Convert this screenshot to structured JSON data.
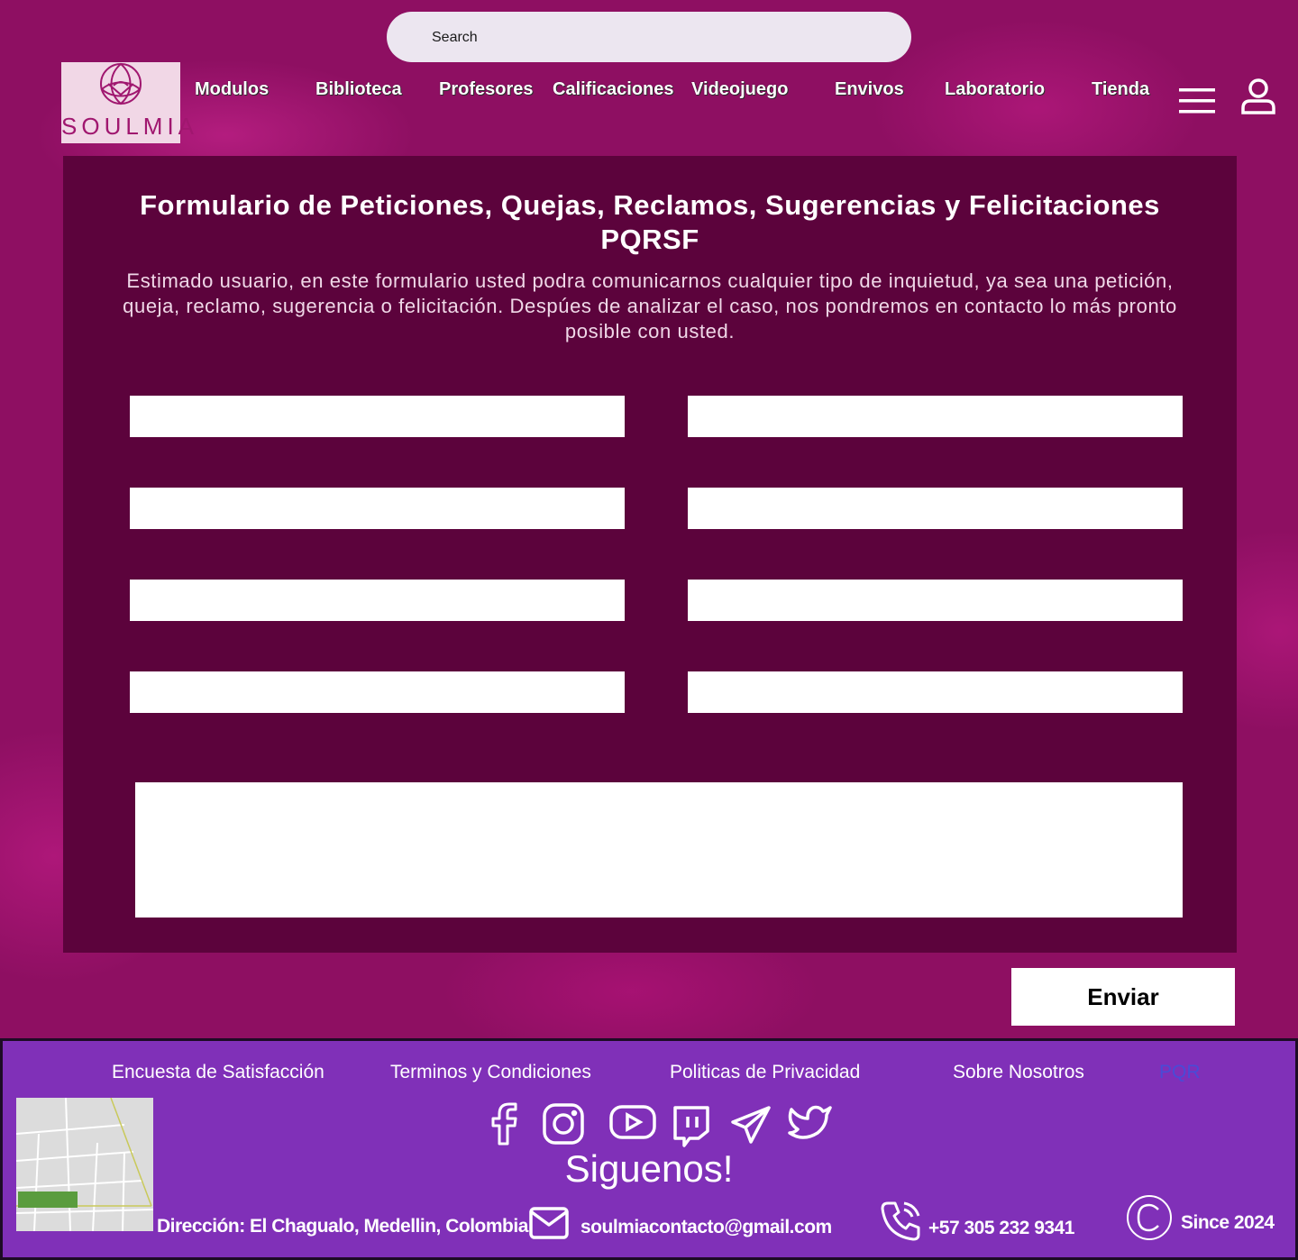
{
  "search": {
    "placeholder": "Search"
  },
  "brand": {
    "name": "SOULMIA"
  },
  "nav": {
    "items": [
      {
        "label": "Modulos"
      },
      {
        "label": "Biblioteca"
      },
      {
        "label": "Profesores"
      },
      {
        "label": "Calificaciones"
      },
      {
        "label": "Videojuego"
      },
      {
        "label": "Envivos"
      },
      {
        "label": "Laboratorio"
      },
      {
        "label": "Tienda"
      }
    ],
    "menu_icon": "hamburger-menu-icon",
    "user_icon": "user-icon"
  },
  "form": {
    "title_line1": "Formulario de Peticiones, Quejas, Reclamos, Sugerencias y Felicitaciones",
    "title_line2": "PQRSF",
    "description": "Estimado usuario, en este formulario usted podra comunicarnos cualquier tipo de inquietud, ya sea una petición, queja, reclamo, sugerencia o felicitación. Despúes de analizar el caso, nos pondremos en contacto lo más pronto posible con usted.",
    "fields": [
      "",
      "",
      "",
      "",
      "",
      "",
      "",
      ""
    ],
    "message": "",
    "submit_label": "Enviar"
  },
  "footer": {
    "links": [
      {
        "label": "Encuesta de Satisfacción"
      },
      {
        "label": "Terminos y Condiciones"
      },
      {
        "label": "Politicas de Privacidad"
      },
      {
        "label": "Sobre Nosotros"
      },
      {
        "label": "PQR"
      }
    ],
    "social_icons": [
      "facebook-icon",
      "instagram-icon",
      "youtube-icon",
      "twitch-icon",
      "telegram-icon",
      "twitter-icon"
    ],
    "follow_text": "Siguenos!",
    "address": "Dirección: El Chagualo, Medellin, Colombia",
    "email": "soulmiacontacto@gmail.com",
    "phone": "+57 305 232 9341",
    "since": "Since 2024"
  },
  "colors": {
    "background": "#8e0f62",
    "panel": "#5c033c",
    "footer": "#8030b8",
    "active_link": "#4a4bd6"
  }
}
